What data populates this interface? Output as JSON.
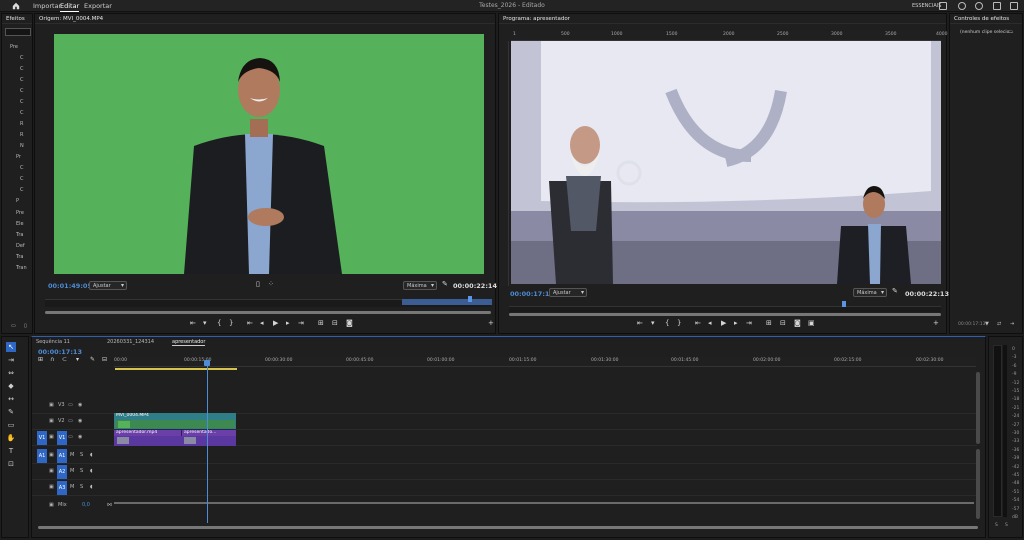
{
  "menu": {
    "importar": "Importar",
    "editar": "Editar",
    "exportar": "Exportar",
    "title": "Testes_2026 - Editado",
    "workspace": "ESSENCIAIS"
  },
  "effects": {
    "title": "Efeitos",
    "items": [
      "Pre",
      "C",
      "C",
      "C",
      "C",
      "C",
      "C",
      "R",
      "R",
      "N",
      "Pr",
      "C",
      "C",
      "C",
      "C",
      "C",
      "C",
      "P",
      "Pre",
      "Ele",
      "Tra",
      "Def",
      "Tra",
      "Tran"
    ]
  },
  "source": {
    "title": "Origem: MVI_0004.MP4",
    "timecode": "00:01:49:05",
    "fit": "Ajustar",
    "quality": "Máxima",
    "duration": "00:00:22:14"
  },
  "program": {
    "title": "Programa: apresentador",
    "timecode": "00:00:17:13",
    "fit": "Ajustar",
    "quality": "Máxima",
    "duration": "00:00:22:13",
    "ruler": [
      "1",
      "500",
      "1000",
      "1500",
      "2000",
      "2500",
      "3000",
      "3500",
      "4000"
    ]
  },
  "effect_controls": {
    "title": "Controles de efeitos",
    "empty": "(nenhum clipe selecio...",
    "time": "00:00:17:13"
  },
  "timeline": {
    "tabs": [
      "Sequência 11",
      "20260331_124314",
      "apresentador"
    ],
    "timecode": "00:00:17:13",
    "ruler": [
      "00:00",
      "00:00:15:00",
      "00:00:30:00",
      "00:00:45:00",
      "00:01:00:00",
      "00:01:15:00",
      "00:01:30:00",
      "00:01:45:00",
      "00:02:00:00",
      "00:02:15:00",
      "00:02:30:00"
    ],
    "tracks": {
      "v3": "V3",
      "v2": "V2",
      "v1": "V1",
      "a1": "A1",
      "a2": "A2",
      "a3": "A3",
      "mix": "Mix",
      "mixval": "0,0",
      "m": "M",
      "s": "S"
    },
    "clips": {
      "green": "MVI_0004.MP4",
      "purple1": "apresentador.mp4",
      "purple2": "apresentado..."
    }
  },
  "meter": {
    "labels": [
      "0",
      "-3",
      "-6",
      "-9",
      "-12",
      "-15",
      "-18",
      "-21",
      "-24",
      "-27",
      "-30",
      "-33",
      "-36",
      "-39",
      "-42",
      "-45",
      "-48",
      "-51",
      "-54",
      "-57",
      "dB"
    ],
    "s1": "S",
    "s2": "S"
  }
}
